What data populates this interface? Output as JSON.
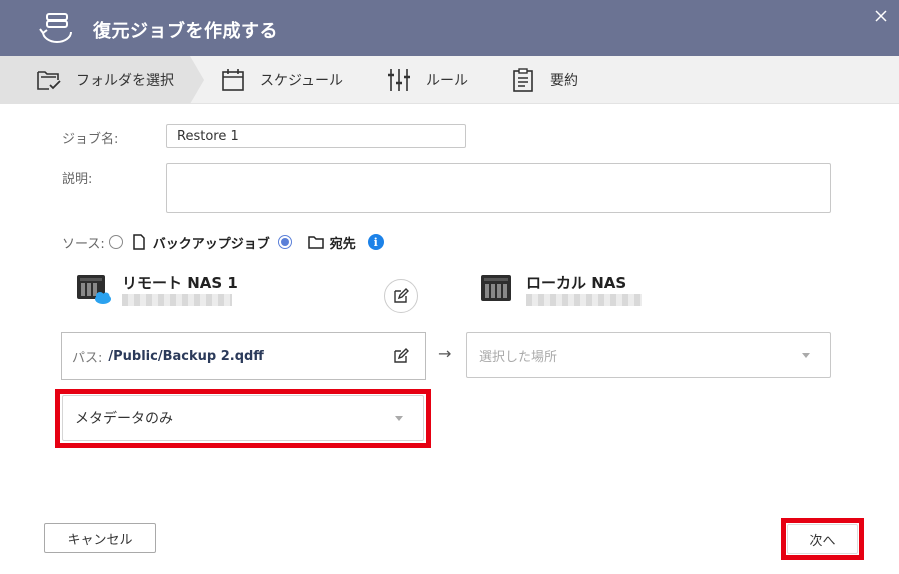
{
  "dialog": {
    "title": "復元ジョブを作成する"
  },
  "steps": [
    {
      "label": "フォルダを選択",
      "icon": "folder-check-icon",
      "active": true
    },
    {
      "label": "スケジュール",
      "icon": "calendar-icon",
      "active": false
    },
    {
      "label": "ルール",
      "icon": "sliders-icon",
      "active": false
    },
    {
      "label": "要約",
      "icon": "clipboard-icon",
      "active": false
    }
  ],
  "form": {
    "job_name_label": "ジョブ名:",
    "job_name_value": "Restore 1",
    "description_label": "説明:",
    "description_value": "",
    "source_label": "ソース:",
    "source_options": [
      {
        "label": "バックアップジョブ",
        "checked": false,
        "icon": "file-icon"
      },
      {
        "label": "宛先",
        "checked": true,
        "icon": "folder-icon"
      }
    ],
    "info_glyph": "i"
  },
  "remote": {
    "name": "リモート NAS 1"
  },
  "local": {
    "name": "ローカル NAS"
  },
  "path": {
    "label": "パス:",
    "value": "/Public/Backup 2.qdff"
  },
  "arrow_glyph": "→",
  "destination_select": {
    "placeholder": "選択した場所"
  },
  "restore_mode_select": {
    "value": "メタデータのみ"
  },
  "buttons": {
    "cancel": "キャンセル",
    "next": "次へ"
  },
  "colors": {
    "titlebar": "#6b7393",
    "highlight": "#e60012",
    "accent": "#5a7fd8",
    "info": "#1c82e8"
  }
}
